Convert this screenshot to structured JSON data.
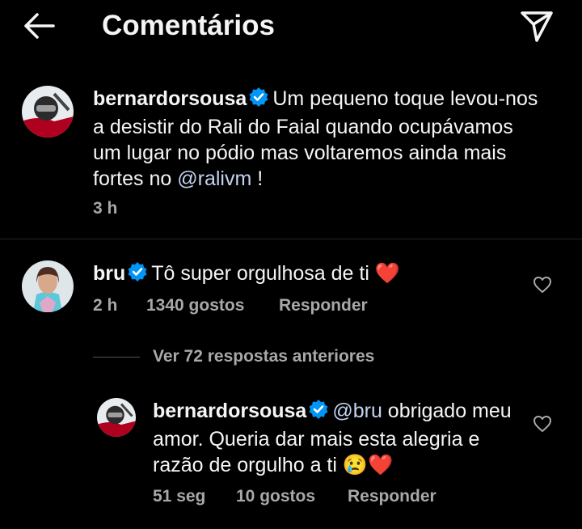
{
  "header": {
    "title": "Comentários",
    "back_icon": "arrow-left-icon",
    "send_icon": "paper-plane-icon"
  },
  "caption": {
    "username": "bernardorsousa",
    "text": "Um pequeno toque levou-nos a desistir do Rali do Faial quando ocupávamos um lugar no pódio mas voltaremos ainda mais fortes no ",
    "mention": "@ralivm",
    "text_end": " !",
    "time": "3 h"
  },
  "comments": [
    {
      "username": "bru",
      "text": "Tô super orgulhosa de ti ",
      "emoji": "❤️",
      "time": "2 h",
      "likes": "1340 gostos",
      "reply_label": "Responder"
    }
  ],
  "view_replies": "Ver 72 respostas anteriores",
  "reply": {
    "username": "bernardorsousa",
    "mention": "@bru",
    "text": " obrigado meu amor. Queria dar mais esta alegria e razão de orgulho a ti ",
    "emoji": "😢❤️",
    "time": "51 seg",
    "likes": "10 gostos",
    "reply_label": "Responder"
  },
  "colors": {
    "background": "#000000",
    "text": "#f5f5f5",
    "secondary": "#a8a8a8",
    "verified": "#0095f6",
    "mention": "#c3d3f0",
    "divider": "#262626"
  }
}
